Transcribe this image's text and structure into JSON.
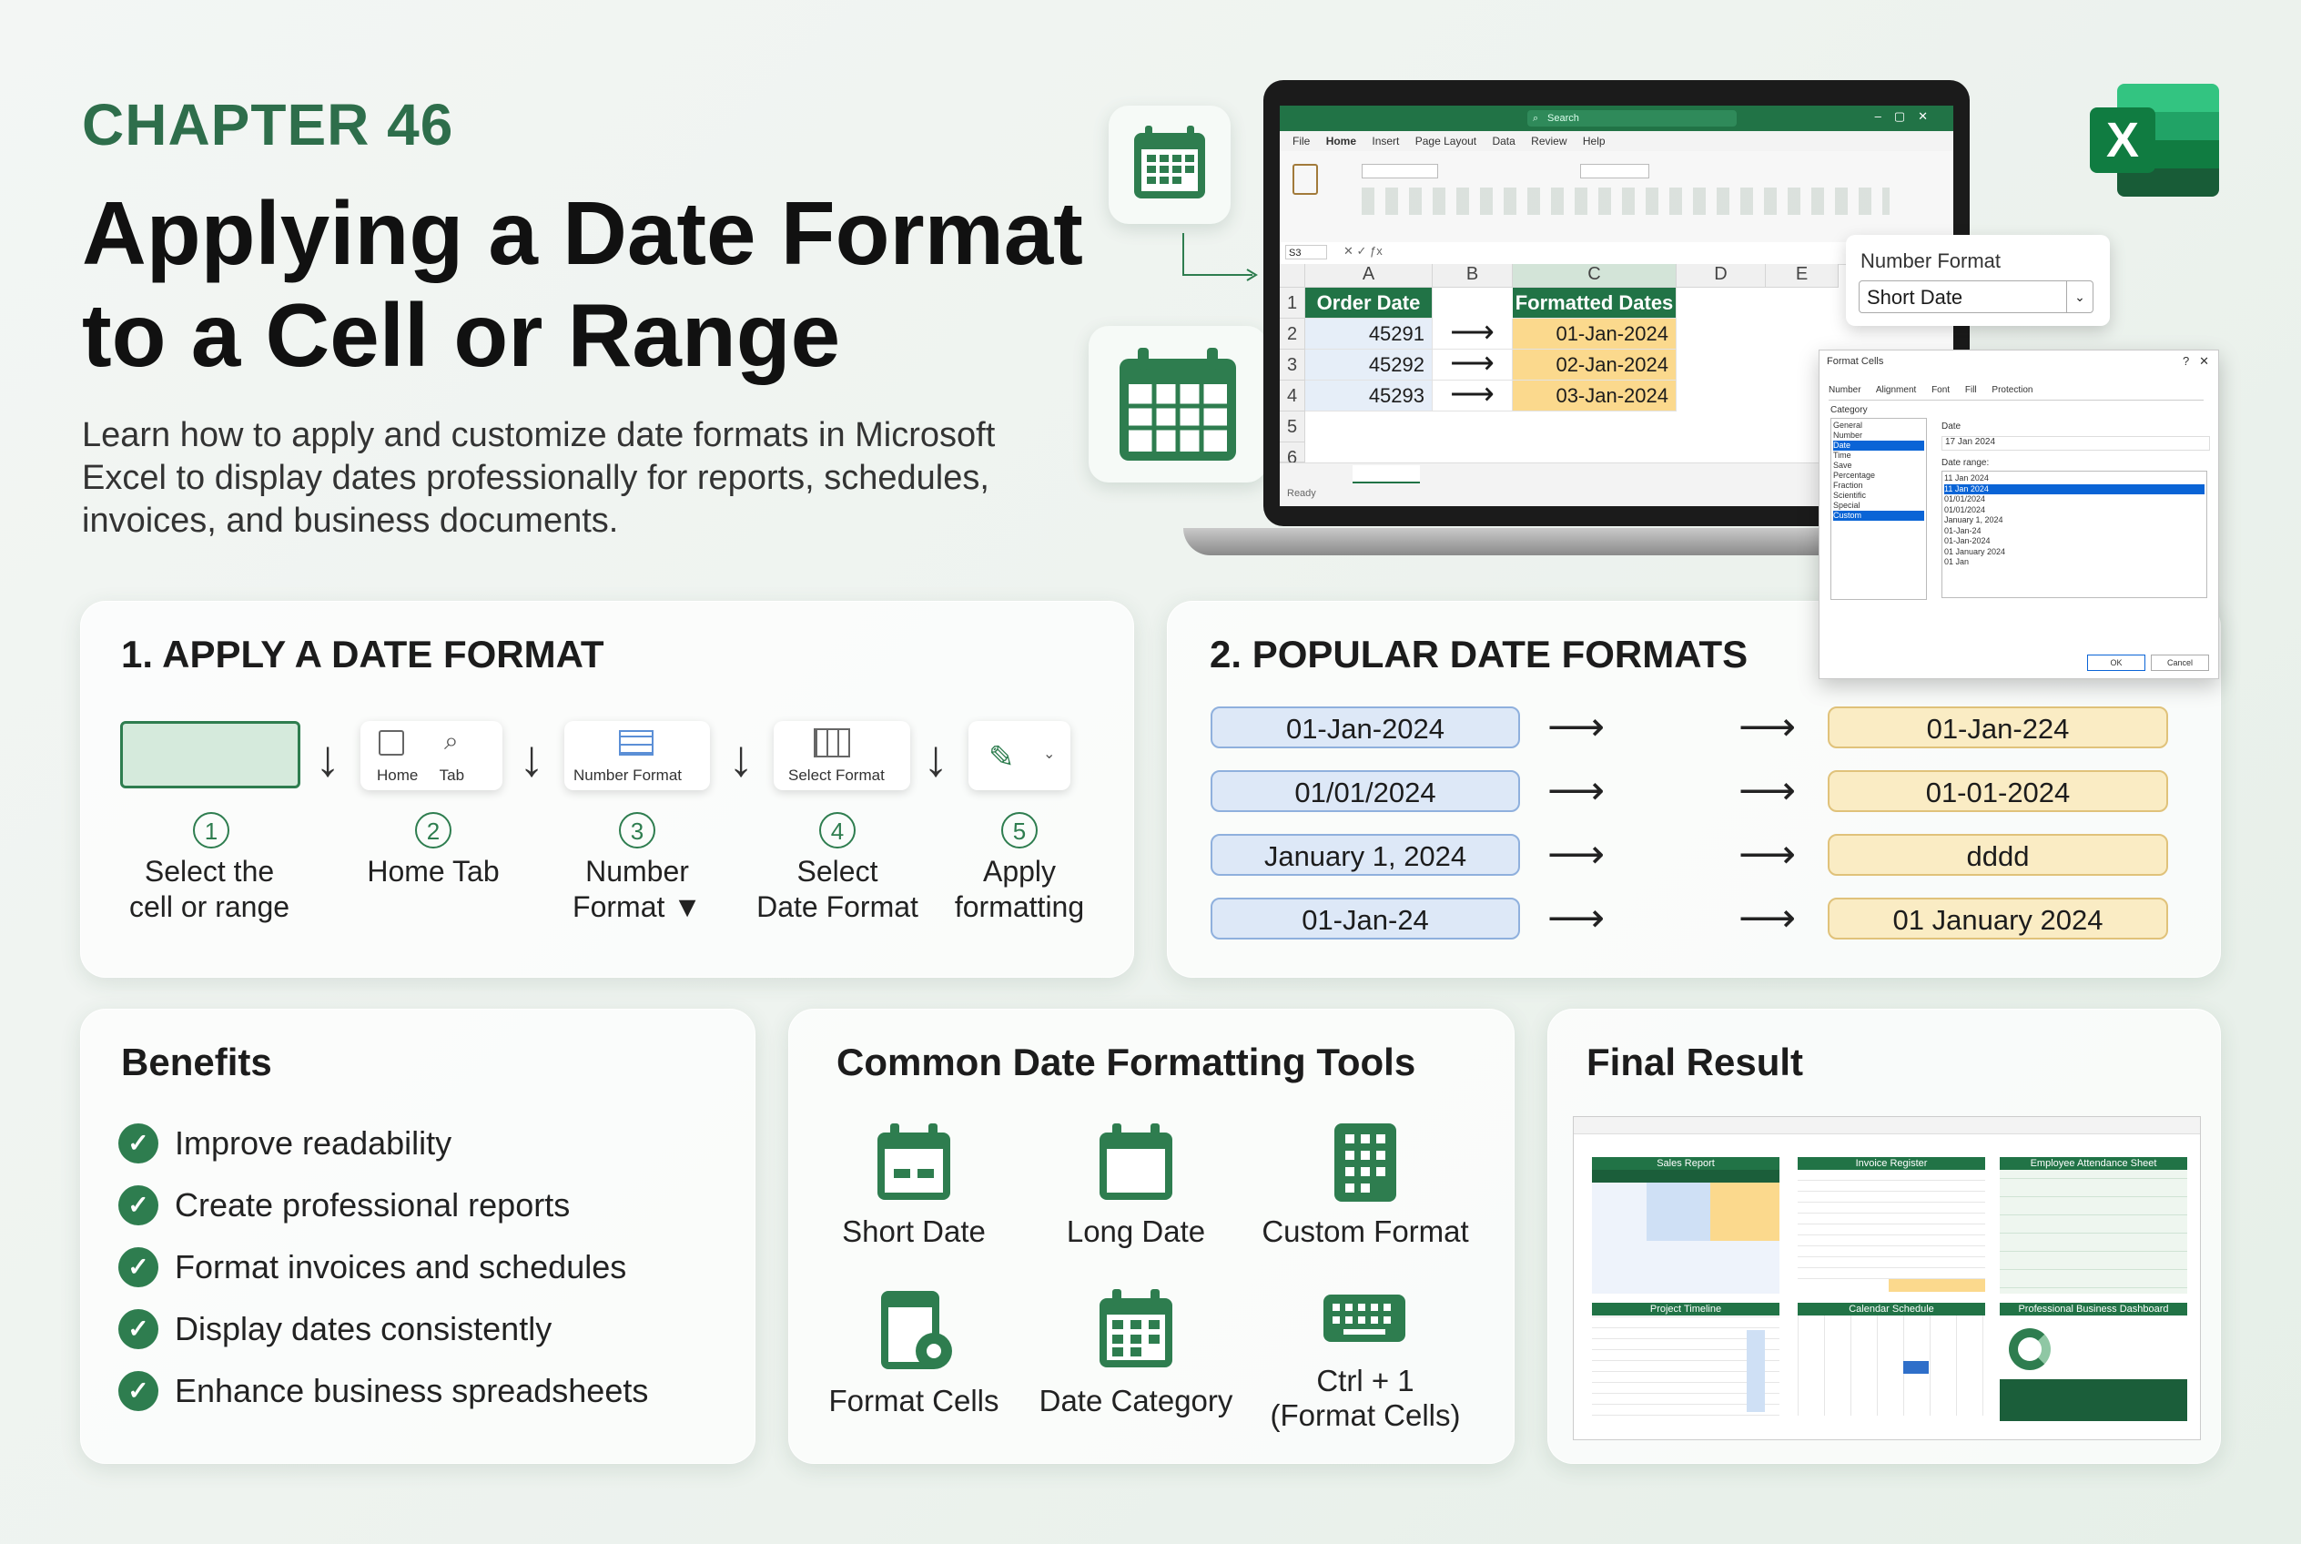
{
  "header": {
    "chapter": "CHAPTER 46",
    "title_line1": "Applying a Date Format",
    "title_line2": "to a Cell or Range",
    "intro": "Learn how to apply and customize date formats in Microsoft Excel to display dates professionally for reports, schedules, invoices, and business documents."
  },
  "colors": {
    "brand_green": "#2e6e4b",
    "excel_green": "#217346",
    "accent_blue": "#dde8f7",
    "accent_yellow": "#faecc4"
  },
  "excel_window": {
    "menu": [
      "File",
      "Home",
      "Insert",
      "Page Layout",
      "Data",
      "Review",
      "Help"
    ],
    "search": "Search",
    "name_box": "S3",
    "col_headers": [
      "A",
      "B",
      "C",
      "D",
      "E"
    ],
    "row_headers": [
      "1",
      "2",
      "3",
      "4",
      "5",
      "6"
    ],
    "header_a": "Order Date",
    "header_c": "Formatted Dates",
    "rows": [
      {
        "raw": "45291",
        "formatted": "01-Jan-2024"
      },
      {
        "raw": "45292",
        "formatted": "02-Jan-2024"
      },
      {
        "raw": "45293",
        "formatted": "03-Jan-2024"
      }
    ],
    "status": "Ready"
  },
  "number_format_popup": {
    "label": "Number Format",
    "value": "Short Date"
  },
  "format_cells_dialog": {
    "title": "Format Cells",
    "tabs": [
      "Number",
      "Alignment",
      "Font",
      "Fill",
      "Protection"
    ],
    "category_label": "Category",
    "categories": [
      "General",
      "Number",
      "Date",
      "Time",
      "Save",
      "Percentage",
      "Fraction",
      "Scientific",
      "Special",
      "Custom"
    ],
    "date_label": "Date",
    "date_sample": "17 Jan 2024",
    "type_label": "Date range:",
    "types": [
      "11 Jan 2024",
      "11 Jan 2024",
      "01/01/2024",
      "01/01/2024",
      "January 1, 2024",
      "01-Jan-24",
      "01-Jan-2024",
      "01 January 2024",
      "01 Jan"
    ],
    "ok": "OK",
    "cancel": "Cancel"
  },
  "section_apply": {
    "title": "1. APPLY A DATE FORMAT",
    "steps": [
      {
        "num": "①",
        "box": "",
        "label_l1": "Select the",
        "label_l2": "cell or range"
      },
      {
        "num": "②",
        "box": "Home     Tab",
        "label_l1": "Home Tab",
        "label_l2": ""
      },
      {
        "num": "③",
        "box": "Number Format",
        "label_l1": "Number",
        "label_l2": "Format ▼"
      },
      {
        "num": "④",
        "box": "Select Format",
        "label_l1": "Select",
        "label_l2": "Date Format"
      },
      {
        "num": "⑤",
        "box": "",
        "label_l1": "Apply",
        "label_l2": "formatting"
      }
    ],
    "arrow": "↓"
  },
  "section_popular": {
    "title": "2. POPULAR DATE FORMATS",
    "arrow": "⟶",
    "rows": [
      {
        "from": "01-Jan-2024",
        "to": "01-Jan-224"
      },
      {
        "from": "01/01/2024",
        "to": "01-01-2024"
      },
      {
        "from": "January 1, 2024",
        "to": "dddd"
      },
      {
        "from": "01-Jan-24",
        "to": "01 January 2024"
      }
    ]
  },
  "benefits": {
    "title": "Benefits",
    "check": "✓",
    "items": [
      "Improve readability",
      "Create professional reports",
      "Format invoices and schedules",
      "Display dates consistently",
      "Enhance business spreadsheets"
    ]
  },
  "tools": {
    "title": "Common Date Formatting Tools",
    "items": [
      {
        "icon": "calendar-short-icon",
        "label": "Short Date"
      },
      {
        "icon": "calendar-long-icon",
        "label": "Long Date"
      },
      {
        "icon": "custom-format-icon",
        "label": "Custom Format"
      },
      {
        "icon": "format-cells-icon",
        "label": "Format Cells"
      },
      {
        "icon": "date-category-icon",
        "label": "Date Category"
      },
      {
        "icon": "keyboard-icon",
        "label": "Ctrl + 1",
        "label2": "(Format Cells)"
      }
    ]
  },
  "final_result": {
    "title": "Final Result",
    "panels": [
      "Sales Report",
      "Invoice Register",
      "Employee Attendance Sheet",
      "Project Timeline",
      "Calendar Schedule",
      "Professional Business Dashboard"
    ]
  }
}
